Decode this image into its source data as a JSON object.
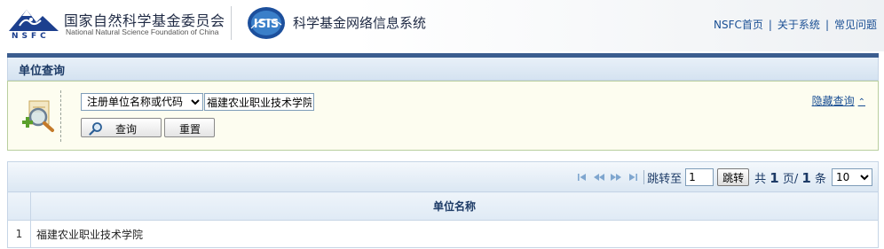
{
  "header": {
    "org_name_cn": "国家自然科学基金委员会",
    "org_name_en": "National Natural Science Foundation of China",
    "org_abbr": "NSFC",
    "isis_logo_text": "ISIS",
    "system_title": "科学基金网络信息系统",
    "links": [
      "NSFC首页",
      "关于系统",
      "常见问题"
    ]
  },
  "query_panel": {
    "title": "单位查询",
    "field_select": {
      "selected": "注册单位名称或代码",
      "options": [
        "注册单位名称或代码"
      ]
    },
    "field_value": "福建农业职业技术学院",
    "query_button": "查询",
    "reset_button": "重置",
    "hide_link": "隐藏查询",
    "hide_link_icon": "double-chevron-up-icon"
  },
  "pager": {
    "jump_label": "跳转至",
    "jump_value": "1",
    "jump_button": "跳转",
    "total_prefix": "共",
    "total_pages": "1",
    "pages_suffix": "页/",
    "total_items": "1",
    "items_suffix": "条",
    "page_size": "10",
    "page_size_options": [
      "10"
    ]
  },
  "results": {
    "columns": [
      "单位名称"
    ],
    "rows": [
      {
        "index": "1",
        "name": "福建农业职业技术学院"
      }
    ]
  },
  "colors": {
    "link_blue": "#1a4f94",
    "header_rule": "#3b5d8f",
    "query_bg": "#fdfdf0",
    "query_border": "#b9cf9f"
  }
}
